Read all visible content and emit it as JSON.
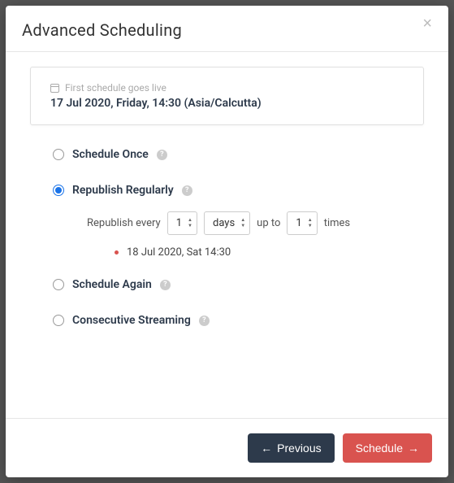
{
  "modal": {
    "title": "Advanced Scheduling"
  },
  "card": {
    "label": "First schedule goes live",
    "value": "17 Jul 2020, Friday, 14:30 (Asia/Calcutta)"
  },
  "options": {
    "once": {
      "label": "Schedule Once",
      "selected": false
    },
    "republish": {
      "label": "Republish Regularly",
      "selected": true
    },
    "again": {
      "label": "Schedule Again",
      "selected": false
    },
    "consecutive": {
      "label": "Consecutive Streaming",
      "selected": false
    }
  },
  "republish": {
    "prefix": "Republish every",
    "interval_value": "1",
    "interval_unit": "days",
    "mid": "up to",
    "count_value": "1",
    "suffix": "times",
    "schedules": [
      "18 Jul 2020, Sat 14:30"
    ]
  },
  "footer": {
    "previous": "Previous",
    "schedule": "Schedule"
  }
}
